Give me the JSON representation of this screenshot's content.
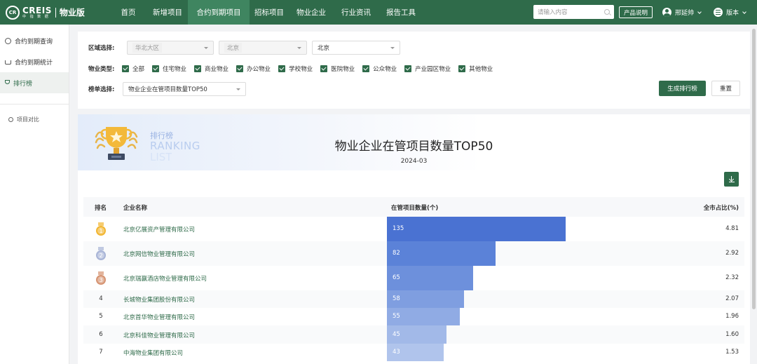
{
  "header": {
    "logo_badge": "CR",
    "logo_brand": "CREIS",
    "logo_sub": "中 指 数 据",
    "product": "物业版",
    "nav": [
      {
        "label": "首页",
        "active": false
      },
      {
        "label": "新增项目",
        "active": false
      },
      {
        "label": "合约到期项目",
        "active": true
      },
      {
        "label": "招标项目",
        "active": false
      },
      {
        "label": "物业企业",
        "active": false
      },
      {
        "label": "行业资讯",
        "active": false
      },
      {
        "label": "报告工具",
        "active": false
      }
    ],
    "search_placeholder": "请输入内容",
    "doc_button": "产品说明",
    "user_name": "邢延帅",
    "version_label": "版本"
  },
  "sidebar": {
    "items": [
      {
        "label": "合约到期查询",
        "icon": "search-icon",
        "active": false
      },
      {
        "label": "合约到期统计",
        "icon": "cart-icon",
        "active": false
      },
      {
        "label": "排行榜",
        "icon": "trophy-icon",
        "active": true
      }
    ],
    "compare_label": "项目对比"
  },
  "filters": {
    "region_label": "区域选择:",
    "region_values": [
      "华北大区",
      "北京",
      "北京"
    ],
    "type_label": "物业类型:",
    "types": [
      "全部",
      "住宅物业",
      "商业物业",
      "办公物业",
      "学校物业",
      "医院物业",
      "公众物业",
      "产业园区物业",
      "其他物业"
    ],
    "list_label": "榜单选择:",
    "list_value": "物业企业在管项目数量TOP50",
    "generate_button": "生成排行榜",
    "reset_button": "重置"
  },
  "ranking": {
    "banner_cn": "排行榜",
    "banner_en": "RANKING",
    "banner_en2": "LIST",
    "title": "物业企业在管项目数量TOP50",
    "date": "2024-03",
    "columns": {
      "rank": "排名",
      "company": "企业名称",
      "count": "在管项目数量(个)",
      "share": "全市占比(%)"
    },
    "max_count": 135,
    "rows": [
      {
        "rank": "1",
        "company": "北京亿展资产管理有限公司",
        "count": 135,
        "share": "4.81",
        "medal": "gold"
      },
      {
        "rank": "2",
        "company": "北京网信物业管理有限公司",
        "count": 82,
        "share": "2.92",
        "medal": "silver"
      },
      {
        "rank": "3",
        "company": "北京瑞赢酒店物业管理有限公司",
        "count": 65,
        "share": "2.32",
        "medal": "bronze"
      },
      {
        "rank": "4",
        "company": "长城物业集团股份有限公司",
        "count": 58,
        "share": "2.07",
        "medal": ""
      },
      {
        "rank": "5",
        "company": "北京首华物业管理有限公司",
        "count": 55,
        "share": "1.96",
        "medal": ""
      },
      {
        "rank": "6",
        "company": "北京科佳物业管理有限公司",
        "count": 45,
        "share": "1.60",
        "medal": ""
      },
      {
        "rank": "7",
        "company": "中海物业集团有限公司",
        "count": 43,
        "share": "1.53",
        "medal": ""
      }
    ]
  }
}
